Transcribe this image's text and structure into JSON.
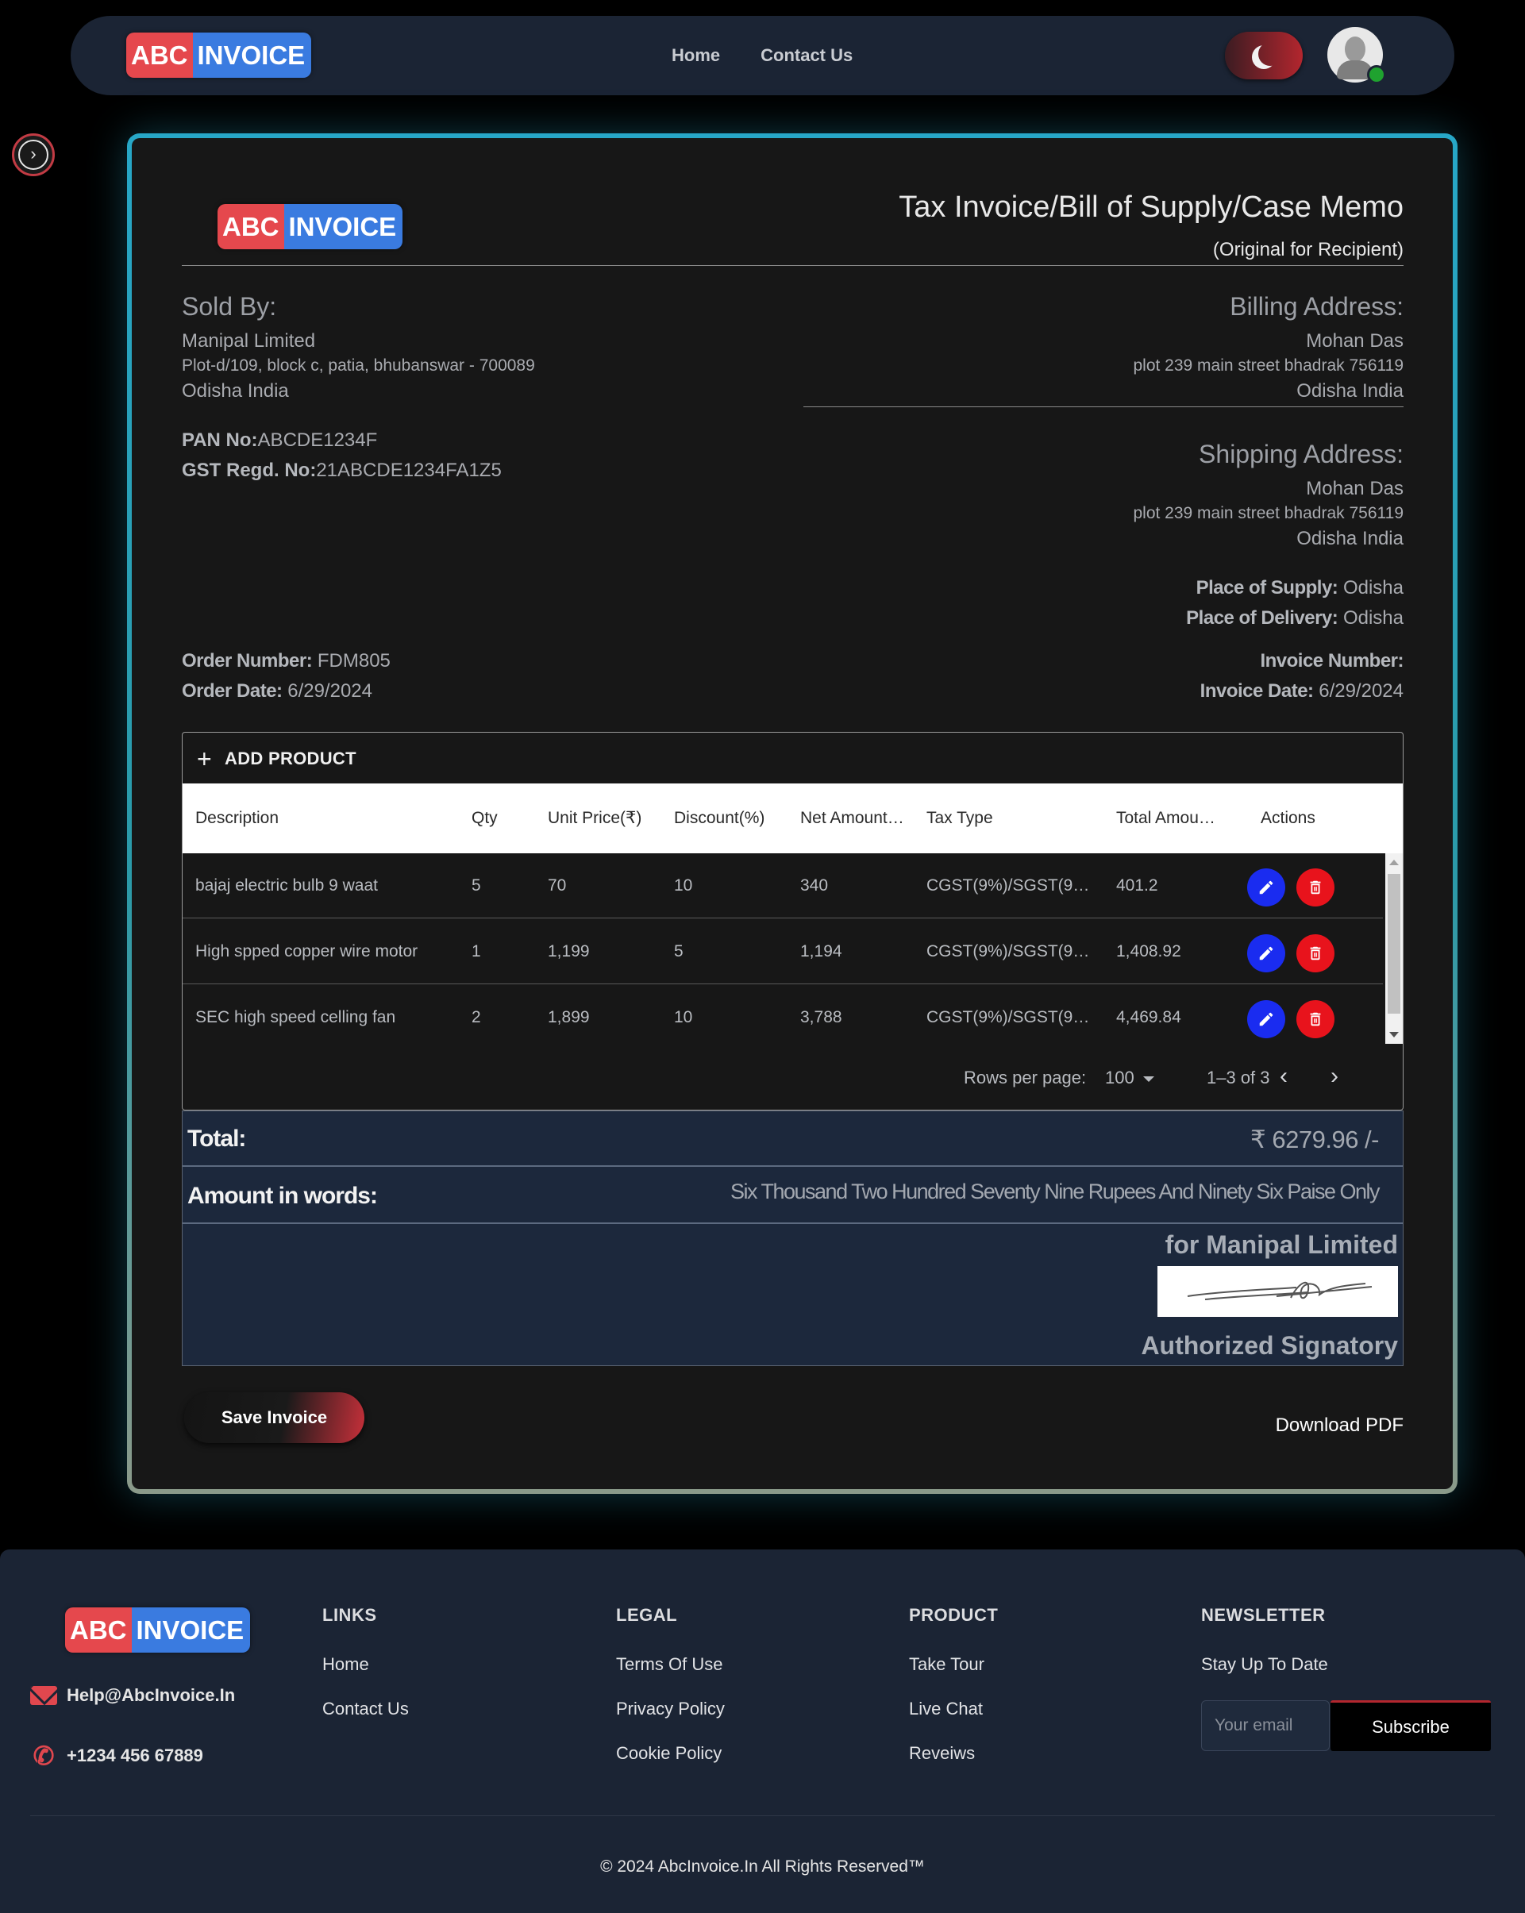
{
  "nav": {
    "logo_part1": "ABC",
    "logo_part2": "INVOICE",
    "links": [
      "Home",
      "Contact Us"
    ]
  },
  "invoice": {
    "logo_part1": "ABC",
    "logo_part2": "INVOICE",
    "title": "Tax Invoice/Bill of Supply/Case Memo",
    "subtitle": "(Original for Recipient)",
    "sold_by": {
      "heading": "Sold By:",
      "name": "Manipal Limited",
      "address": "Plot-d/109, block c, patia, bhubanswar - 700089",
      "region": "Odisha India",
      "pan_label": "PAN No:",
      "pan": "ABCDE1234F",
      "gst_label": "GST Regd. No:",
      "gst": "21ABCDE1234FA1Z5"
    },
    "billing": {
      "heading": "Billing Address:",
      "name": "Mohan Das",
      "address": "plot 239 main street bhadrak 756119",
      "region": "Odisha India"
    },
    "shipping": {
      "heading": "Shipping Address:",
      "name": "Mohan Das",
      "address": "plot 239 main street bhadrak 756119",
      "region": "Odisha India"
    },
    "place_supply_label": "Place of Supply:",
    "place_supply": "Odisha",
    "place_delivery_label": "Place of Delivery:",
    "place_delivery": "Odisha",
    "order_number_label": "Order Number:",
    "order_number": "FDM805",
    "order_date_label": "Order Date:",
    "order_date": "6/29/2024",
    "invoice_number_label": "Invoice Number:",
    "invoice_number": "",
    "invoice_date_label": "Invoice Date:",
    "invoice_date": "6/29/2024",
    "add_product": "ADD PRODUCT",
    "columns": [
      "Description",
      "Qty",
      "Unit Price(₹)",
      "Discount(%)",
      "Net Amount…",
      "Tax Type",
      "Total Amou…",
      "Actions"
    ],
    "rows": [
      {
        "description": "bajaj electric bulb 9 waat",
        "qty": "5",
        "unit_price": "70",
        "discount": "10",
        "net": "340",
        "tax": "CGST(9%)/SGST(9…",
        "total": "401.2"
      },
      {
        "description": "High spped copper wire motor",
        "qty": "1",
        "unit_price": "1,199",
        "discount": "5",
        "net": "1,194",
        "tax": "CGST(9%)/SGST(9…",
        "total": "1,408.92"
      },
      {
        "description": "SEC high speed celling fan",
        "qty": "2",
        "unit_price": "1,899",
        "discount": "10",
        "net": "3,788",
        "tax": "CGST(9%)/SGST(9…",
        "total": "4,469.84"
      }
    ],
    "rows_per_page_label": "Rows per page:",
    "rows_per_page": "100",
    "range": "1–3 of 3",
    "total_label": "Total:",
    "total_value": "₹ 6279.96 /-",
    "words_label": "Amount in words:",
    "words_value": "Six Thousand Two Hundred Seventy Nine Rupees And Ninety Six Paise Only",
    "for_company": "for Manipal Limited",
    "authorized": "Authorized Signatory",
    "save_button": "Save Invoice",
    "download_pdf": "Download PDF"
  },
  "footer": {
    "logo_part1": "ABC",
    "logo_part2": "INVOICE",
    "email": "Help@AbcInvoice.In",
    "phone": "+1234 456 67889",
    "links_heading": "LINKS",
    "links": [
      "Home",
      "Contact Us"
    ],
    "legal_heading": "LEGAL",
    "legal": [
      "Terms Of Use",
      "Privacy Policy",
      "Cookie Policy"
    ],
    "product_heading": "PRODUCT",
    "product": [
      "Take Tour",
      "Live Chat",
      "Reveiws"
    ],
    "newsletter_heading": "NEWSLETTER",
    "newsletter_text": "Stay Up To Date",
    "email_placeholder": "Your email",
    "subscribe": "Subscribe",
    "copyright": "© 2024 AbcInvoice.In All Rights Reserved™"
  },
  "colors": {
    "accent_red": "#e5484d",
    "accent_blue": "#3a7be0",
    "card_border": "#27a7c7",
    "edit_button": "#1a2cf0",
    "delete_button": "#e8131c"
  },
  "icons": [
    "moon-icon",
    "avatar",
    "chevron-right-icon",
    "plus-icon",
    "edit-icon",
    "delete-icon",
    "chevron-left-icon",
    "mail-icon",
    "phone-icon"
  ]
}
